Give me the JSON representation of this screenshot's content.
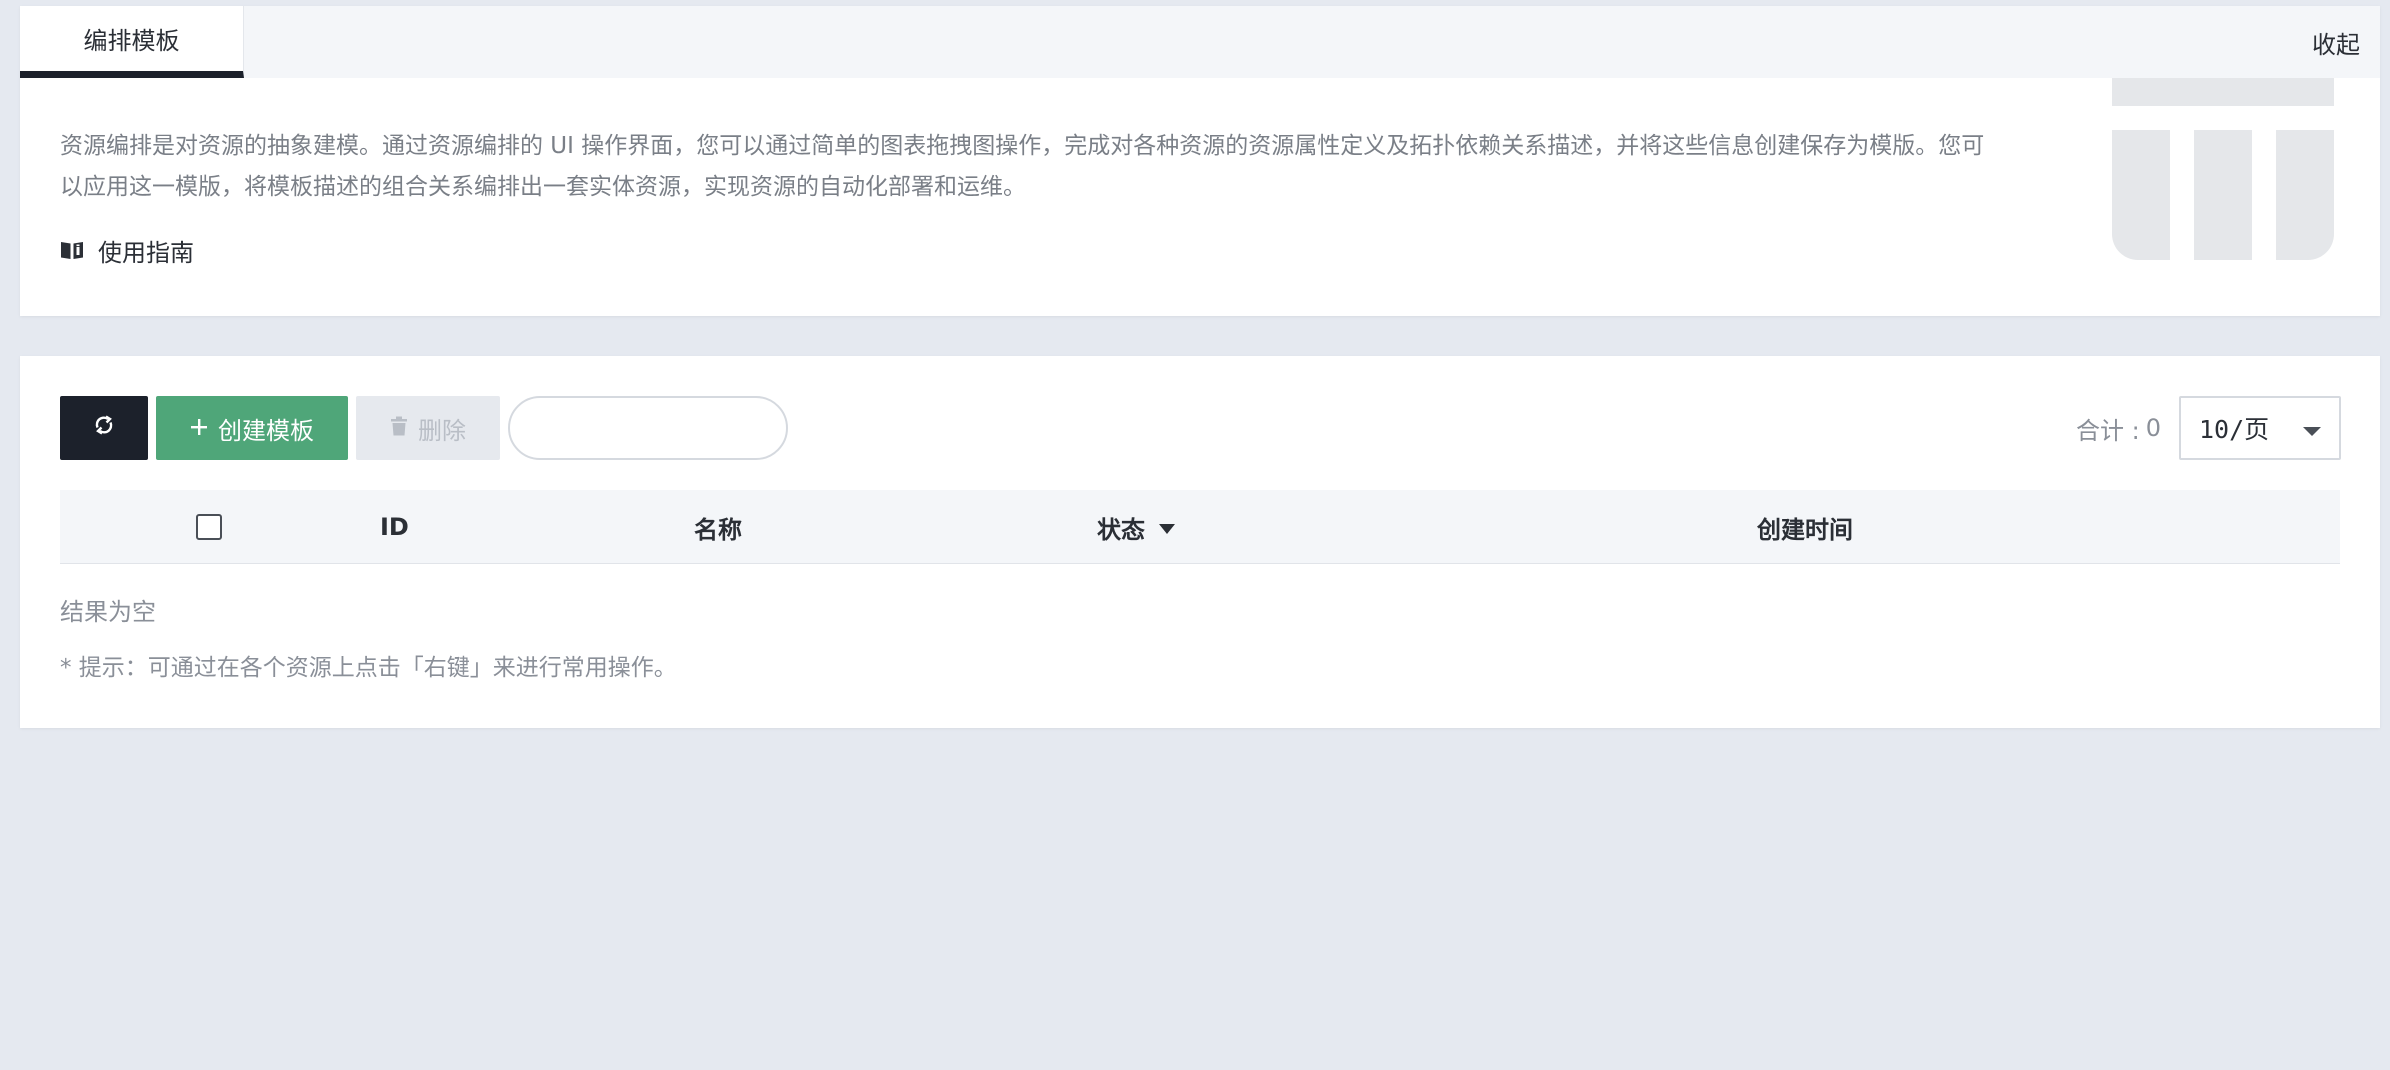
{
  "intro": {
    "tab_label": "编排模板",
    "collapse_label": "收起",
    "description": "资源编排是对资源的抽象建模。通过资源编排的 UI 操作界面，您可以通过简单的图表拖拽图操作，完成对各种资源的资源属性定义及拓扑依赖关系描述，并将这些信息创建保存为模版。您可以应用这一模版，将模板描述的组合关系编排出一套实体资源，实现资源的自动化部署和运维。",
    "guide_label": "使用指南",
    "guide_icon": "book-icon"
  },
  "toolbar": {
    "refresh_icon": "refresh-icon",
    "create_label": "创建模板",
    "create_icon": "plus-icon",
    "delete_label": "删除",
    "delete_icon": "trash-icon",
    "search_placeholder": ""
  },
  "pagination": {
    "total_label": "合计 :",
    "total_count": "0",
    "page_size": "10/页"
  },
  "table": {
    "columns": [
      "ID",
      "名称",
      "状态",
      "创建时间"
    ],
    "rows": [],
    "empty_text": "结果为空",
    "tip_text": "* 提示：可通过在各个资源上点击「右键」来进行常用操作。"
  },
  "colors": {
    "page_bg": "#e5e9f0",
    "primary_dark": "#1c212b",
    "create_green": "#4fa679",
    "disabled_bg": "#e6e9ee",
    "muted_text": "#8a8f98"
  }
}
